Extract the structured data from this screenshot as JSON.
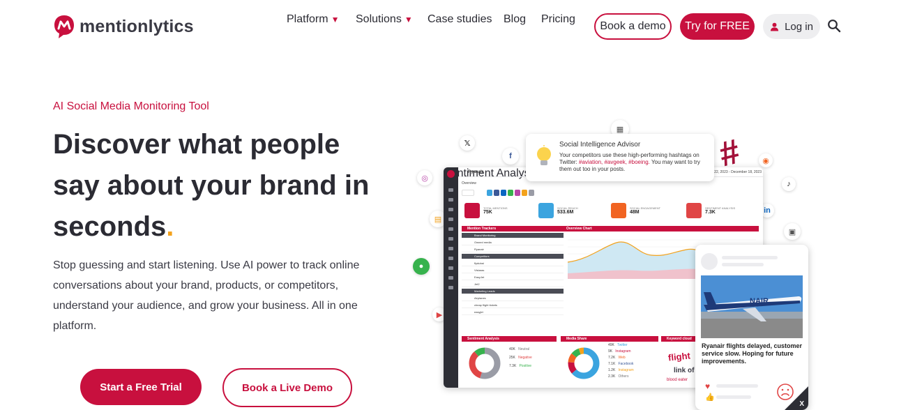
{
  "brand": {
    "name": "mentionlytics",
    "color": "#c8103e",
    "accent": "#f3a21c"
  },
  "nav": {
    "items": [
      {
        "label": "Platform",
        "has_caret": true
      },
      {
        "label": "Solutions",
        "has_caret": true
      },
      {
        "label": "Case studies",
        "has_caret": false
      },
      {
        "label": "Blog",
        "has_caret": false
      },
      {
        "label": "Pricing",
        "has_caret": false
      }
    ],
    "caret_glyph": "▼",
    "book_demo": "Book a demo",
    "try_free": "Try for FREE",
    "login": "Log in",
    "search_icon": "search-icon",
    "user_icon": "user-icon"
  },
  "hero": {
    "eyebrow": "AI Social Media Monitoring Tool",
    "headline_line1": "Discover what people",
    "headline_line2": "say about your brand in",
    "headline_line3": "seconds",
    "headline_dot": ".",
    "subcopy": "Stop guessing and start listening. Use AI power to track online conversations about your brand, products, or competitors, understand your audience, and grow your business. All in one platform.",
    "cta_primary": "Start a Free Trial",
    "cta_secondary": "Book a Live Demo"
  },
  "illustration": {
    "advisor": {
      "title": "Social Intelligence Advisor",
      "body_prefix": "Your competitors use these high-performing hashtags on Twitter: ",
      "hashtags": "#aviation, #avgeek, #boeing.",
      "body_suffix": " You may want to try them out too in your posts."
    },
    "dashboard": {
      "project": "Ryanair",
      "breadcrumb": "Overview",
      "date_range": "October 22, 2023 - December 18, 2023",
      "kpis": [
        {
          "title": "TOTAL MENTIONS",
          "value": "75K",
          "color": "#c8103e"
        },
        {
          "title": "SOCIAL REACH",
          "value": "533.6M",
          "color": "#3ba4df"
        },
        {
          "title": "SOCIAL ENGAGEMENT",
          "value": "48M",
          "color": "#f16422"
        },
        {
          "title": "SENTIMENT ANALYSIS",
          "value": "7.3K",
          "color": "#e04545"
        }
      ],
      "panels": {
        "trackers": "Mention Trackers",
        "overview": "Overview Chart",
        "sentiment_chart": "Sentiment Analysis",
        "sentiment": "Sentiment Analysis",
        "media_share": "Media Share",
        "keyword_cloud": "Keyword cloud"
      },
      "tracker_rows": [
        {
          "label": "Brand Monitoring",
          "dark": true
        },
        {
          "label": "Owned media",
          "dark": false
        },
        {
          "label": "Ryanair",
          "dark": false
        },
        {
          "label": "Competitors",
          "dark": true
        },
        {
          "label": "flydubai",
          "dark": false
        },
        {
          "label": "Vistaras",
          "dark": false
        },
        {
          "label": "EasyJet",
          "dark": false
        },
        {
          "label": "Jet2",
          "dark": false
        },
        {
          "label": "Marketing Leads",
          "dark": true
        },
        {
          "label": "Airplanes",
          "dark": false
        },
        {
          "label": "cheap flight tickets",
          "dark": false
        },
        {
          "label": "easyjet",
          "dark": false
        }
      ],
      "sentiment_legend": [
        {
          "value": "40K",
          "label": "Neutral",
          "color": "#9a9ca6"
        },
        {
          "value": "25K",
          "label": "Negative",
          "color": "#e04545"
        },
        {
          "value": "7.3K",
          "label": "Positive",
          "color": "#37b24d"
        }
      ],
      "media_legend": [
        {
          "value": "49K",
          "label": "Twitter",
          "color": "#3ba4df"
        },
        {
          "value": "9K",
          "label": "Instagram",
          "color": "#c8103e"
        },
        {
          "value": "7.2K",
          "label": "Web",
          "color": "#f16422"
        },
        {
          "value": "7.1K",
          "label": "Facebook",
          "color": "#3b5998"
        },
        {
          "value": "1.2K",
          "label": "Instagram",
          "color": "#f3a21c"
        },
        {
          "value": "2.3K",
          "label": "Others",
          "color": "#9a9ca6"
        }
      ],
      "cloud_words": [
        "flight",
        "link of",
        "blood eater"
      ]
    },
    "post": {
      "text": "Ryanair flights delayed, customer service slow. Hoping for future improvements.",
      "platform": "X"
    }
  }
}
